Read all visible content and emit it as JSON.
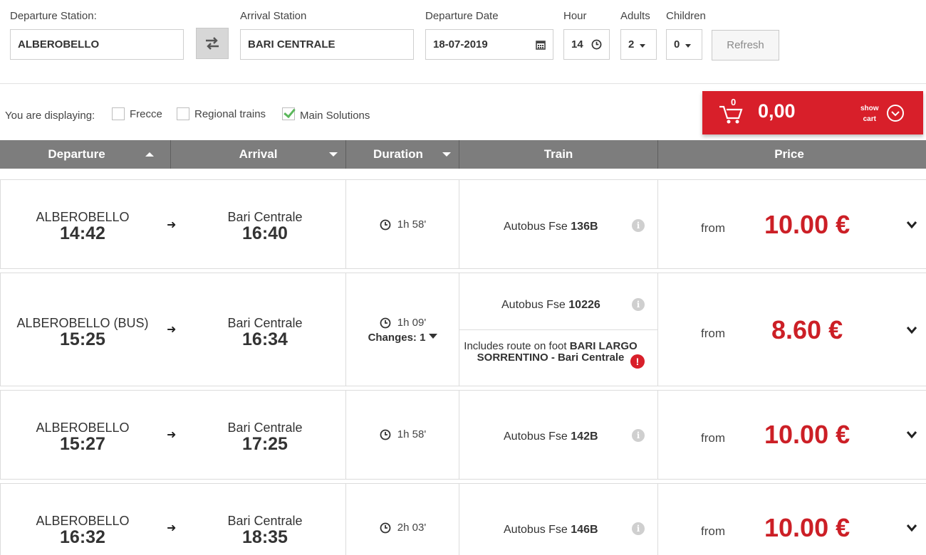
{
  "search": {
    "departure_label": "Departure Station:",
    "departure_value": "ALBEROBELLO",
    "arrival_label": "Arrival Station",
    "arrival_value": "BARI CENTRALE",
    "date_label": "Departure Date",
    "date_value": "18-07-2019",
    "hour_label": "Hour",
    "hour_value": "14",
    "adults_label": "Adults",
    "adults_value": "2",
    "children_label": "Children",
    "children_value": "0",
    "refresh_label": "Refresh"
  },
  "filters": {
    "lead": "You are displaying:",
    "options": [
      {
        "label": "Frecce",
        "checked": false
      },
      {
        "label": "Regional trains",
        "checked": false
      },
      {
        "label": "Main Solutions",
        "checked": true
      }
    ]
  },
  "cart": {
    "count": "0",
    "total": "0,00",
    "show_line1": "show",
    "show_line2": "cart"
  },
  "table": {
    "headers": [
      "Departure",
      "Arrival",
      "Duration",
      "Train",
      "Price"
    ]
  },
  "solutions": [
    {
      "dep_station": "ALBEROBELLO",
      "dep_time": "14:42",
      "arr_station": "Bari Centrale",
      "arr_time": "16:40",
      "duration": "1h 58'",
      "train_prefix": "Autobus Fse ",
      "train_number": "136B",
      "from": "from",
      "price": "10.00 €"
    },
    {
      "dep_station": "ALBEROBELLO (BUS)",
      "dep_time": "15:25",
      "arr_station": "Bari Centrale",
      "arr_time": "16:34",
      "duration": "1h 09'",
      "changes": "Changes: 1",
      "train_prefix": "Autobus Fse ",
      "train_number": "10226",
      "foot_prefix": "Includes route on foot ",
      "foot_route": "BARI LARGO SORRENTINO - Bari Centrale",
      "from": "from",
      "price": "8.60 €"
    },
    {
      "dep_station": "ALBEROBELLO",
      "dep_time": "15:27",
      "arr_station": "Bari Centrale",
      "arr_time": "17:25",
      "duration": "1h 58'",
      "train_prefix": "Autobus Fse ",
      "train_number": "142B",
      "from": "from",
      "price": "10.00 €"
    },
    {
      "dep_station": "ALBEROBELLO",
      "dep_time": "16:32",
      "arr_station": "Bari Centrale",
      "arr_time": "18:35",
      "duration": "2h 03'",
      "train_prefix": "Autobus Fse ",
      "train_number": "146B",
      "from": "from",
      "price": "10.00 €"
    }
  ],
  "colors": {
    "brand_red": "#d81f2a",
    "price_red": "#cc1f26",
    "header_gray": "#7d7d7d"
  }
}
